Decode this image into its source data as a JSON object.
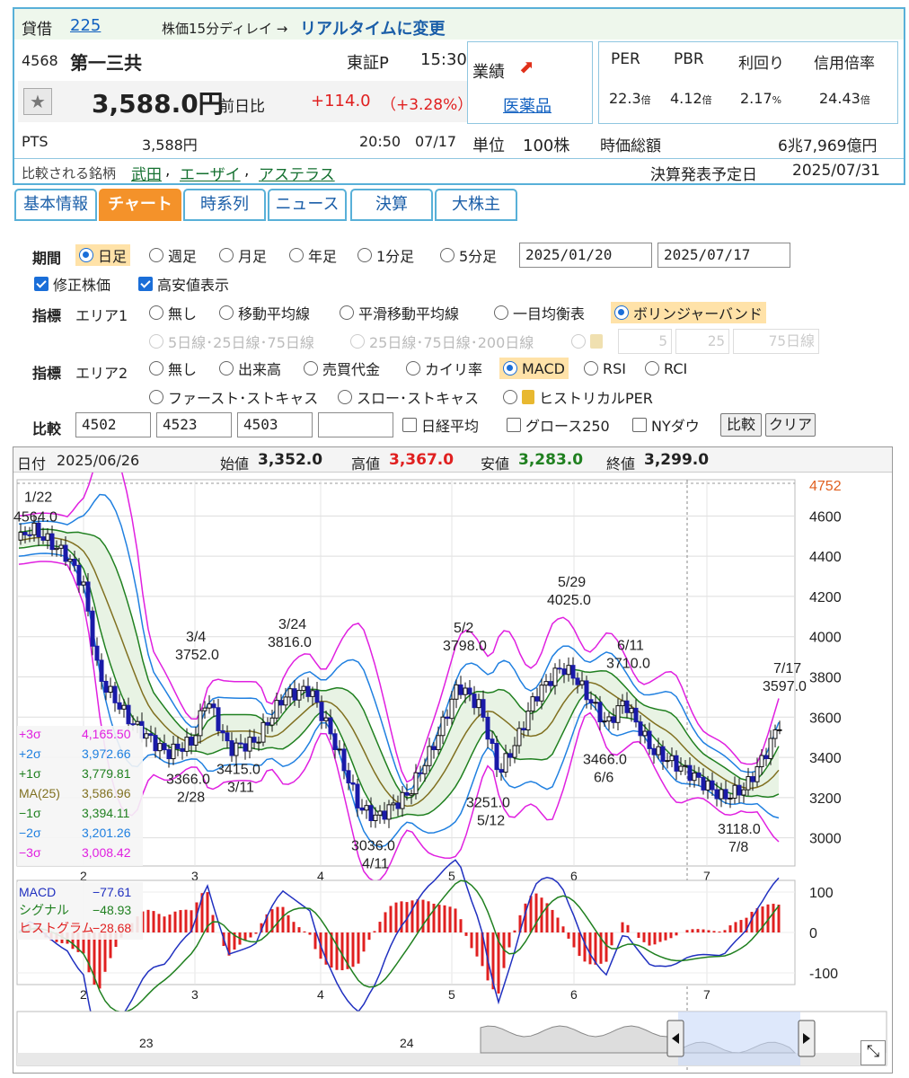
{
  "header": {
    "lend_label": "貸借",
    "lend_code": "225",
    "delay_note": "株価15分ディレイ →",
    "realtime_link": "リアルタイムに変更",
    "code": "4568",
    "name": "第一三共",
    "market": "東証P",
    "time": "15:30",
    "price": "3,588.0円",
    "prev_label": "前日比",
    "change": "+114.0",
    "change_pct": "（+3.28%）",
    "pts_label": "PTS",
    "pts_price": "3,588円",
    "pts_time": "20:50",
    "pts_date": "07/17",
    "perf_label": "業績",
    "sector": "医薬品",
    "unit_label": "単位",
    "unit_value": "100株",
    "per_label": "PER",
    "pbr_label": "PBR",
    "yield_label": "利回り",
    "margin_label": "信用倍率",
    "per": "22.3",
    "per_unit": "倍",
    "pbr": "4.12",
    "pbr_unit": "倍",
    "yield": "2.17",
    "yield_unit": "%",
    "margin": "24.43",
    "margin_unit": "倍",
    "mcap_label": "時価総額",
    "mcap": "6兆7,969億円",
    "compare_label": "比較される銘柄",
    "compare": [
      "武田",
      "エーザイ",
      "アステラス"
    ],
    "earnings_label": "決算発表予定日",
    "earnings_date": "2025/07/31"
  },
  "tabs": [
    "基本情報",
    "チャート",
    "時系列",
    "ニュース",
    "決算",
    "大株主"
  ],
  "controls": {
    "period_label": "期間",
    "periods": [
      "日足",
      "週足",
      "月足",
      "年足",
      "1分足",
      "5分足"
    ],
    "date_from": "2025/01/20",
    "date_to": "2025/07/17",
    "adj_label": "修正株価",
    "hl_label": "高安値表示",
    "ind_label": "指標",
    "area1_label": "エリア1",
    "area1_opts": [
      "無し",
      "移動平均線",
      "平滑移動平均線",
      "一目均衡表",
      "ボリンジャーバンド"
    ],
    "ma_opts": [
      "5日線･25日線･75日線",
      "25日線･75日線･200日線"
    ],
    "ma_vals": [
      "5",
      "25",
      "75日線"
    ],
    "area2_label": "エリア2",
    "area2_opts": [
      "無し",
      "出来高",
      "売買代金",
      "カイリ率",
      "MACD",
      "RSI",
      "RCI"
    ],
    "area2_opts_b": [
      "ファースト･ストキャス",
      "スロー･ストキャス",
      "ヒストリカルPER"
    ],
    "cmp_label": "比較",
    "cmp_codes": [
      "4502",
      "4523",
      "4503",
      ""
    ],
    "cmp_opts": [
      "日経平均",
      "グロース250",
      "NYダウ"
    ],
    "cmp_btn": "比較",
    "clear_btn": "クリア"
  },
  "ohlc_bar": {
    "date_label": "日付",
    "date": "2025/06/26",
    "open_label": "始値",
    "open": "3,352.0",
    "high_label": "高値",
    "high": "3,367.0",
    "low_label": "安値",
    "low": "3,283.0",
    "close_label": "終値",
    "close": "3,299.0"
  },
  "chart_data": {
    "type": "candlestick",
    "y_ticks": [
      3000,
      3200,
      3400,
      3600,
      3800,
      4000,
      4200,
      4400,
      4600
    ],
    "y_top_label": "4752",
    "x_ticks": [
      "2",
      "3",
      "4",
      "5",
      "6",
      "7"
    ],
    "annotations": [
      {
        "date": "1/22",
        "value": "4564.0"
      },
      {
        "date": "3/4",
        "value": "3752.0"
      },
      {
        "date": "2/28",
        "value": "3366.0"
      },
      {
        "date": "3/11",
        "value": "3415.0"
      },
      {
        "date": "3/24",
        "value": "3816.0"
      },
      {
        "date": "4/11",
        "value": "3036.0"
      },
      {
        "date": "5/2",
        "value": "3798.0"
      },
      {
        "date": "5/12",
        "value": "3251.0"
      },
      {
        "date": "5/29",
        "value": "4025.0"
      },
      {
        "date": "6/11",
        "value": "3710.0"
      },
      {
        "date": "6/6",
        "value": "3466.0"
      },
      {
        "date": "7/8",
        "value": "3118.0"
      },
      {
        "date": "7/17",
        "value": "3597.0"
      }
    ],
    "bollinger_legend": [
      {
        "name": "+3σ",
        "value": "4,165.50",
        "color": "#e020e0"
      },
      {
        "name": "+2σ",
        "value": "3,972.66",
        "color": "#2080e0"
      },
      {
        "name": "+1σ",
        "value": "3,779.81",
        "color": "#208020"
      },
      {
        "name": "MA(25)",
        "value": "3,586.96",
        "color": "#807020"
      },
      {
        "name": "−1σ",
        "value": "3,394.11",
        "color": "#208020"
      },
      {
        "name": "−2σ",
        "value": "3,201.26",
        "color": "#2080e0"
      },
      {
        "name": "−3σ",
        "value": "3,008.42",
        "color": "#e020e0"
      }
    ],
    "macd_legend": [
      {
        "name": "MACD",
        "value": "−77.61",
        "color": "#2030c0"
      },
      {
        "name": "シグナル",
        "value": "−48.93",
        "color": "#208020"
      },
      {
        "name": "ヒストグラム",
        "value": "−28.68",
        "color": "#e02020"
      }
    ],
    "macd_ticks": [
      "100",
      "0",
      "-100"
    ],
    "nav_labels": [
      "23",
      "24"
    ]
  }
}
